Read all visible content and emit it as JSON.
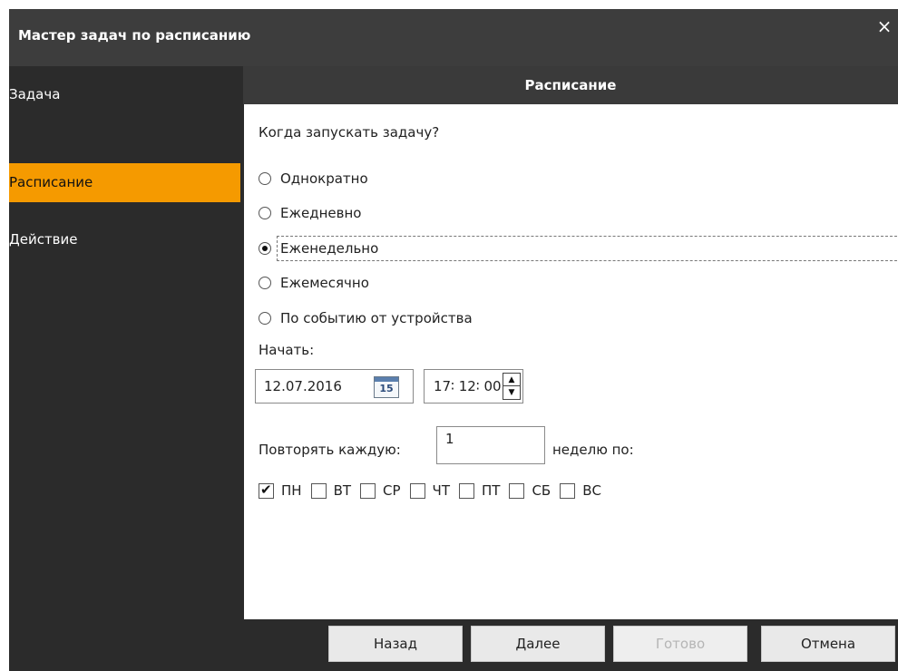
{
  "window": {
    "title": "Мастер задач по расписанию",
    "close_icon": "×"
  },
  "section": {
    "title": "Расписание"
  },
  "sidebar": {
    "items": [
      {
        "label": "Задача",
        "active": false
      },
      {
        "label": "Расписание",
        "active": true
      },
      {
        "label": "Действие",
        "active": false
      }
    ]
  },
  "schedule": {
    "question": "Когда запускать задачу?",
    "options": [
      {
        "label": "Однократно",
        "checked": false
      },
      {
        "label": "Ежедневно",
        "checked": false
      },
      {
        "label": "Еженедельно",
        "checked": true
      },
      {
        "label": "Ежемесячно",
        "checked": false
      },
      {
        "label": "По событию от устройства",
        "checked": false
      }
    ],
    "start_label": "Начать:",
    "date_value": "12.07.2016",
    "calendar_day": "15",
    "time_value": "17∶ 12∶ 00",
    "spin_up": "▲",
    "spin_down": "▼",
    "repeat_label": "Повторять каждую:",
    "repeat_value": "1",
    "weeks_label": "неделю по:",
    "days": [
      {
        "label": "ПН",
        "checked": true
      },
      {
        "label": "ВТ",
        "checked": false
      },
      {
        "label": "СР",
        "checked": false
      },
      {
        "label": "ЧТ",
        "checked": false
      },
      {
        "label": "ПТ",
        "checked": false
      },
      {
        "label": "СБ",
        "checked": false
      },
      {
        "label": "ВС",
        "checked": false
      }
    ]
  },
  "buttons": {
    "back": "Назад",
    "next": "Далее",
    "finish": "Готово",
    "cancel": "Отмена"
  },
  "colors": {
    "accent": "#f59a00",
    "titlebar": "#3d3d3d",
    "sidebar": "#2b2b2b"
  }
}
